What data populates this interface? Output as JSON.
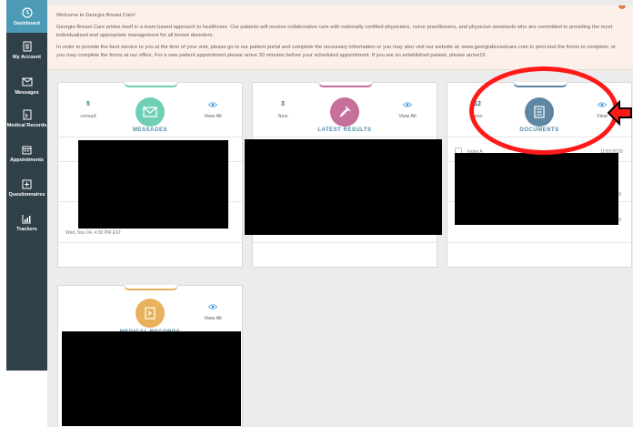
{
  "sidebar": {
    "items": [
      {
        "label": "Dashboard",
        "icon": "dashboard-icon",
        "active": true
      },
      {
        "label": "My Account",
        "icon": "account-icon"
      },
      {
        "label": "Messages",
        "icon": "envelope-icon"
      },
      {
        "label": "Medical Records",
        "icon": "medical-records-icon"
      },
      {
        "label": "Appointments",
        "icon": "calendar-icon"
      },
      {
        "label": "Questionnaires",
        "icon": "clipboard-icon"
      },
      {
        "label": "Trackers",
        "icon": "chart-icon"
      }
    ]
  },
  "welcome": {
    "greeting": "Welcome to Georgia Breast Care!",
    "para1": "Georgia Breast Care prides itself in a team based approach to healthcare.  Our patients will receive collaborative care with nationally certified physicians, nurse practitioners, and physician assistants who are committed to providing the most individualized and appropriate management for all breast disorders.",
    "para2": "In order to provide the best service to you at the time of your visit, please go to our patient portal and complete the necessary information or you may also visit our website at: www.georgiabreastcare.com to print tout the forms to complete, or you may complete the forms at our office.  For a new patient appointment please arrive 30 minutes before your scheduled appointment.  If you are an established patient, please arrive15"
  },
  "cards": {
    "messages": {
      "count": "5",
      "count_label": "unread",
      "view_all": "View All",
      "title": "MESSAGES",
      "date": "Wed, Nov 04, 4:30 PM EST"
    },
    "results": {
      "count": "3",
      "count_label": "New",
      "view_all": "View All",
      "title": "LATEST RESULTS"
    },
    "documents": {
      "count": "12",
      "count_label": "New",
      "view_all": "View",
      "title": "DOCUMENTS",
      "row1_name": "Index A",
      "row1_date": "11/02/2020",
      "row2_date": "2020",
      "row3_date": "2020"
    },
    "medical": {
      "view_all": "View All",
      "title": "MEDICAL RECORDS"
    }
  },
  "colors": {
    "sidebar": "#2f4049",
    "active": "#4c9ab5",
    "messages": "#6fcfb5",
    "results": "#c56f9a",
    "documents": "#5f87a3",
    "medical": "#eab15b",
    "annotation": "#ff1a1a"
  }
}
